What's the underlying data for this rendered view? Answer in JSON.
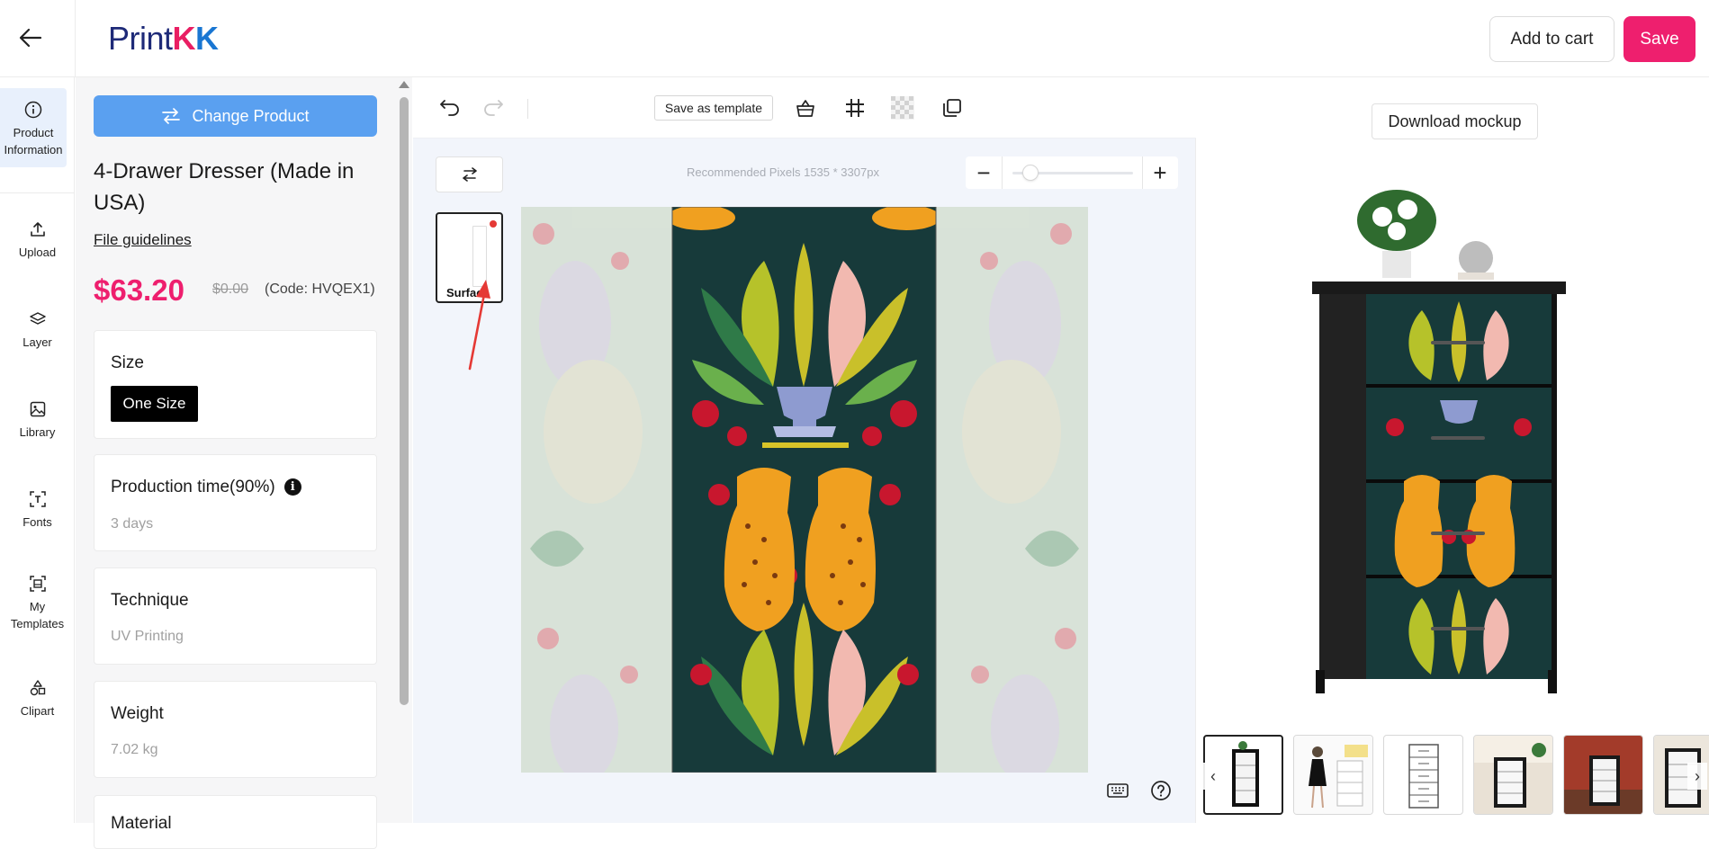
{
  "header": {
    "logo": {
      "part1": "Print",
      "part2": "K",
      "part3": "K"
    },
    "add_to_cart": "Add to cart",
    "save": "Save"
  },
  "rail": {
    "items": [
      {
        "label1": "Product",
        "label2": "Information",
        "icon": "info-icon",
        "active": true
      },
      {
        "label1": "Upload",
        "label2": "",
        "icon": "upload-icon"
      },
      {
        "label1": "Layer",
        "label2": "",
        "icon": "layers-icon"
      },
      {
        "label1": "Library",
        "label2": "",
        "icon": "image-icon"
      },
      {
        "label1": "Fonts",
        "label2": "",
        "icon": "text-icon"
      },
      {
        "label1": "My",
        "label2": "Templates",
        "icon": "template-icon"
      },
      {
        "label1": "Clipart",
        "label2": "",
        "icon": "shapes-icon"
      }
    ]
  },
  "product": {
    "change_button": "Change Product",
    "title": "4-Drawer Dresser (Made in USA)",
    "guidelines": "File guidelines",
    "price": "$63.20",
    "old_price": "$0.00",
    "code": "(Code: HVQEX1)",
    "size": {
      "label": "Size",
      "selected": "One Size"
    },
    "production": {
      "label": "Production time(90%)",
      "value": "3 days"
    },
    "technique": {
      "label": "Technique",
      "value": "UV Printing"
    },
    "weight": {
      "label": "Weight",
      "value": "7.02 kg"
    },
    "material": {
      "label": "Material"
    }
  },
  "editor": {
    "save_template": "Save as template",
    "recommended": "Recommended Pixels 1535 * 3307px",
    "surface_label": "Surface",
    "zoom": {
      "minus": "−",
      "plus": "+",
      "level": 0.15
    }
  },
  "mockup": {
    "download": "Download mockup",
    "thumbnails": [
      "dresser-front",
      "model-with-dresser",
      "dresser-white",
      "dresser-room",
      "dresser-red-room",
      "dresser-partial"
    ]
  },
  "colors": {
    "accent_pink": "#ee1f6e",
    "accent_blue": "#5aa0f0",
    "rail_active": "#e8f0fc"
  }
}
